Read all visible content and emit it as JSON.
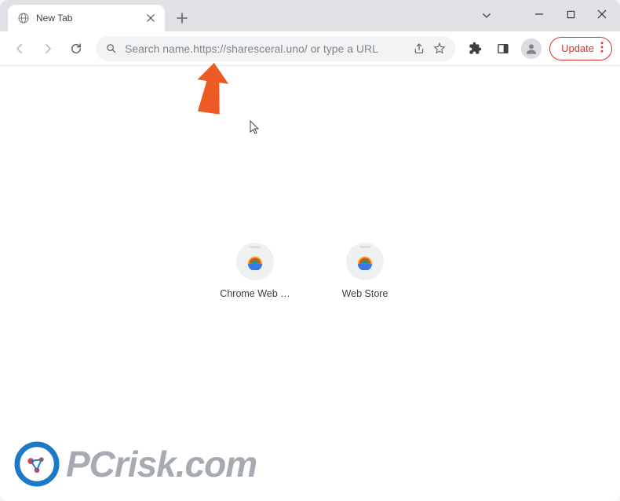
{
  "titlebar": {
    "tab_title": "New Tab"
  },
  "toolbar": {
    "omnibox_placeholder": "Search name.https://sharesceral.uno/ or type a URL",
    "update_label": "Update"
  },
  "shortcuts": [
    {
      "label": "Chrome Web …"
    },
    {
      "label": "Web Store"
    }
  ],
  "watermark": {
    "text": "PCrisk.com"
  }
}
